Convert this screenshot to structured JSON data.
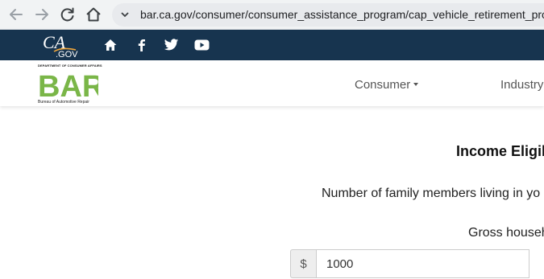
{
  "browser": {
    "url": "bar.ca.gov/consumer/consumer_assistance_program/cap_vehicle_retirement_prog"
  },
  "top_strip": {
    "logo_text": "CA.GOV",
    "icons": [
      "home-icon",
      "facebook-icon",
      "twitter-icon",
      "youtube-icon"
    ],
    "background": "#17344f"
  },
  "header": {
    "logo": {
      "letters": "BAR",
      "dept_text": "DEPARTMENT OF CONSUMER AFFAIRS",
      "caption": "Bureau of Automotive Repair",
      "color": "#7ab648"
    },
    "nav": [
      {
        "label": "Consumer"
      },
      {
        "label": "Industry"
      }
    ]
  },
  "main": {
    "heading": "Income Eligibil",
    "family_question": "Number of family members living in yo",
    "gross_label": "Gross househ",
    "currency_symbol": "$",
    "income_value": "1000"
  }
}
